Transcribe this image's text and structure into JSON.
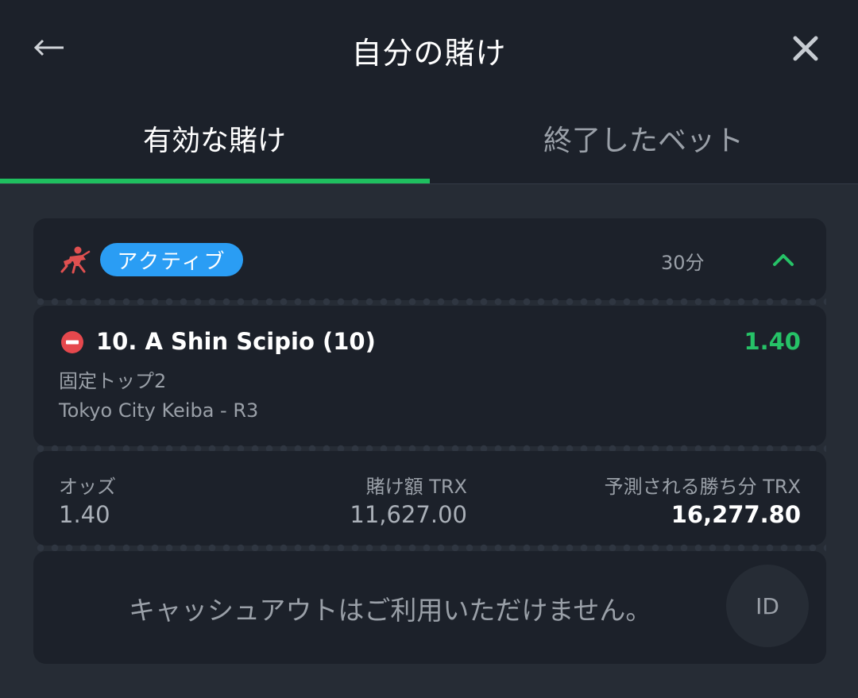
{
  "header": {
    "title": "自分の賭け",
    "back_icon": "arrow-left-icon",
    "close_icon": "close-icon"
  },
  "tabs": [
    {
      "label": "有効な賭け",
      "active": true
    },
    {
      "label": "終了したベット",
      "active": false
    }
  ],
  "bet": {
    "sport_icon": "horse-racing-icon",
    "status_badge": "アクティブ",
    "time": "30分",
    "selection": {
      "name": "10. A Shin Scipio (10)",
      "odds": "1.40",
      "market": "固定トップ2",
      "event": "Tokyo City Keiba - R3"
    },
    "stats": {
      "odds_label": "オッズ",
      "odds_value": "1.40",
      "stake_label": "賭け額 TRX",
      "stake_value": "11,627.00",
      "win_label": "予測される勝ち分 TRX",
      "win_value": "16,277.80"
    },
    "cashout_text": "キャッシュアウトはご利用いただけません。",
    "id_button": "ID"
  },
  "colors": {
    "accent_green": "#1fbf5f",
    "badge_blue": "#2a9df4",
    "stop_red": "#e5484d",
    "odds_green": "#26c267"
  }
}
